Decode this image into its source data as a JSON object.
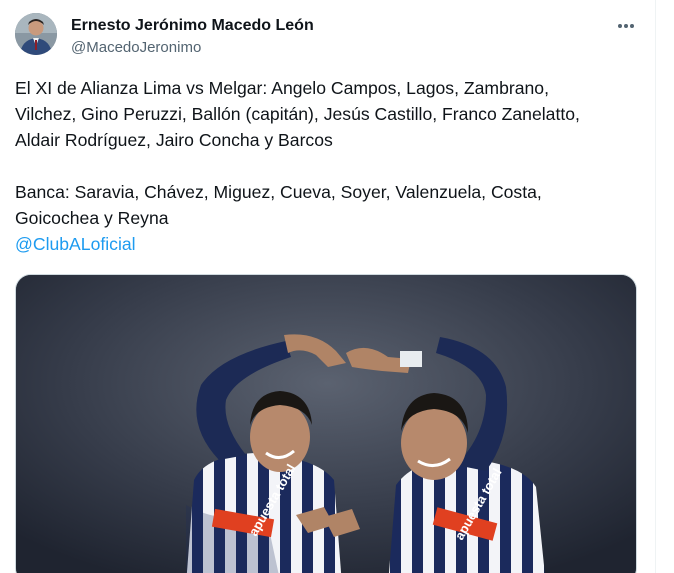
{
  "tweet": {
    "author_name": "Ernesto Jerónimo Macedo León",
    "author_handle": "@MacedoJeronimo",
    "lines_p1": [
      "El XI de Alianza Lima vs Melgar: Angelo Campos, Lagos, Zambrano,",
      "Vilchez, Gino Peruzzi, Ballón (capitán), Jesús Castillo, Franco Zanelatto,",
      "Aldair Rodríguez, Jairo Concha y Barcos"
    ],
    "lines_p2": [
      "Banca: Saravia, Chávez, Miguez, Cueva, Soyer, Valenzuela, Costa,",
      "Goicochea y Reyna"
    ],
    "mention": "@ClubALoficial",
    "jersey_text": "apuesta total"
  },
  "icons": {
    "more": "more-horizontal-icon"
  },
  "colors": {
    "link": "#1d9bf0",
    "secondary_text": "#536471",
    "border": "#cfd9de"
  }
}
